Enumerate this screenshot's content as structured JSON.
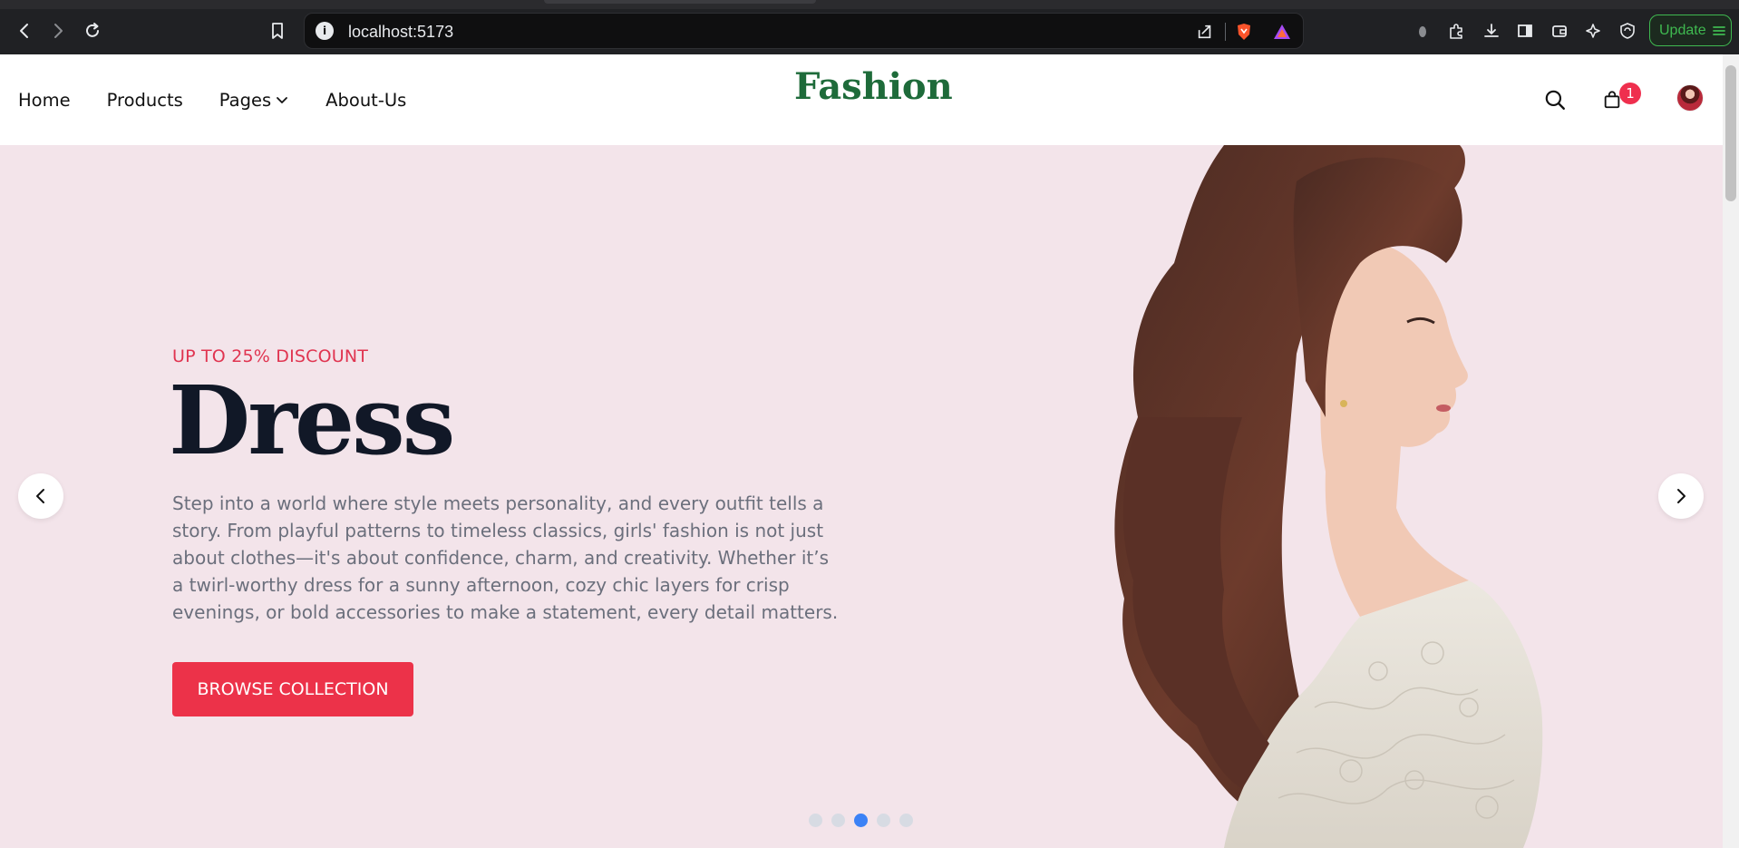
{
  "browser": {
    "url": "localhost:5173",
    "update_label": "Update",
    "accent": "#3fb950"
  },
  "site": {
    "logo": "Fashion",
    "brand_color": "#1e6b3a",
    "nav": [
      {
        "label": "Home"
      },
      {
        "label": "Products"
      },
      {
        "label": "Pages"
      },
      {
        "label": "About-Us"
      }
    ],
    "cart_count": "1",
    "icons": [
      "search-icon",
      "shopping-bag-icon",
      "avatar"
    ]
  },
  "hero": {
    "discount": "UP TO 25% DISCOUNT",
    "title": "Dress",
    "description": "Step into a world where style meets personality, and every outfit tells a story. From playful patterns to timeless classics, girls' fashion is not just about clothes—it's about confidence, charm, and creativity. Whether it’s a twirl-worthy dress for a sunny afternoon, cozy chic layers for crisp evenings, or bold accessories to make a statement, every detail matters.",
    "cta_label": "BROWSE COLLECTION",
    "background": "#f3e4ea",
    "accent": "#ec3249",
    "carousel": {
      "slide_count": 5,
      "active_index": 2
    }
  }
}
